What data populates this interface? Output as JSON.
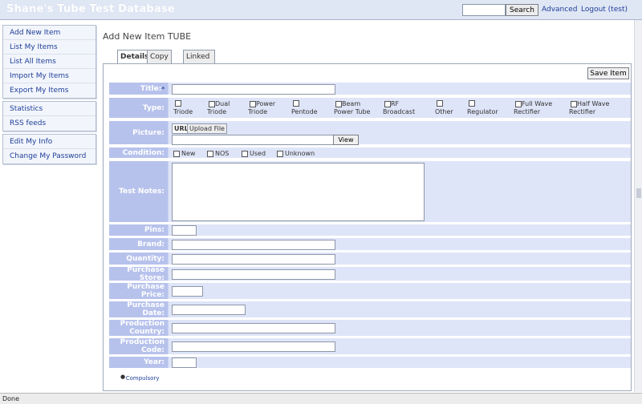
{
  "header": {
    "title": "Shane's Tube Test Database",
    "search_button": "Search",
    "advanced_link": "Advanced",
    "logout_link": "Logout (test)"
  },
  "sidebar": {
    "group1": [
      "Add New Item",
      "List My Items",
      "List All Items",
      "Import My Items",
      "Export My Items"
    ],
    "group2": [
      "Statistics",
      "RSS feeds"
    ],
    "group3": [
      "Edit My Info",
      "Change My Password"
    ]
  },
  "page_title": "Add New Item TUBE",
  "tabs": [
    "Details",
    "Copy Info",
    "Linked Item(s)"
  ],
  "save_button": "Save Item",
  "form": {
    "title_label": "Title:",
    "title_star": "*",
    "type_label": "Type:",
    "type_options": [
      "Triode",
      "Dual Triode",
      "Power Triode",
      "Pentode",
      "Beam Power Tube",
      "RF Broadcast",
      "Other",
      "Regulator",
      "Full Wave Rectifier",
      "Half Wave Rectifier"
    ],
    "picture_label": "Picture:",
    "picture_tabs": [
      "URL",
      "Upload File"
    ],
    "view_button": "View",
    "condition_label": "Condition:",
    "condition_options": [
      "New",
      "NOS",
      "Used",
      "Unknown"
    ],
    "test_notes_label": "Test Notes:",
    "pins_label": "Pins:",
    "brand_label": "Brand:",
    "quantity_label": "Quantity:",
    "purchase_store_label": "Purchase Store:",
    "purchase_price_label": "Purchase Price:",
    "purchase_date_label": "Purchase Date:",
    "production_country_label": "Production Country:",
    "production_code_label": "Production Code:",
    "year_label": "Year:"
  },
  "compulsory_note": "* Compulsory",
  "status_text": "Done"
}
